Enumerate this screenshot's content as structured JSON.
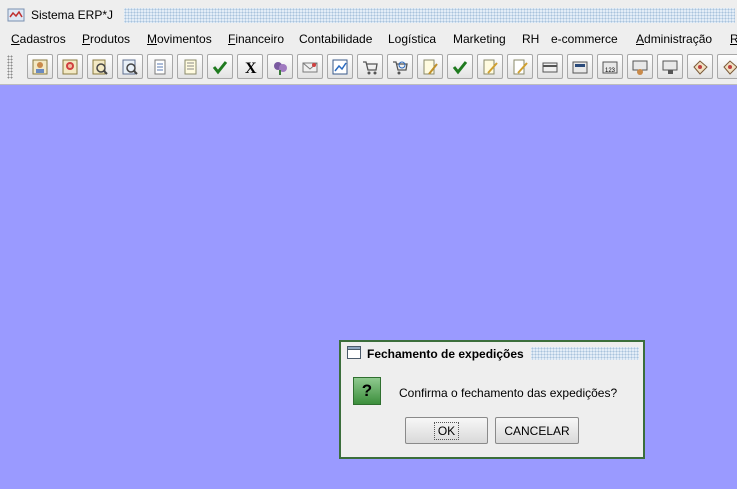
{
  "window": {
    "title": "Sistema ERP*J"
  },
  "menubar": {
    "items": [
      {
        "label": "Cadastros",
        "mnemonic": "C",
        "rest": "adastros"
      },
      {
        "label": "Produtos",
        "mnemonic": "P",
        "rest": "rodutos"
      },
      {
        "label": "Movimentos",
        "mnemonic": "M",
        "rest": "ovimentos"
      },
      {
        "label": "Financeiro",
        "mnemonic": "F",
        "rest": "inanceiro"
      },
      {
        "label": "Contabilidade",
        "mnemonic": "",
        "rest": "Contabilidade"
      },
      {
        "label": "Logística",
        "mnemonic": "",
        "rest": "Logística"
      },
      {
        "label": "Marketing",
        "mnemonic": "",
        "rest": "Marketing"
      },
      {
        "label": "RH",
        "mnemonic": "",
        "rest": "RH"
      },
      {
        "label": "e-commerce",
        "mnemonic": "",
        "rest": "e-commerce"
      },
      {
        "label": "Administração",
        "mnemonic": "A",
        "rest": "dministração"
      },
      {
        "label": "R",
        "mnemonic": "R",
        "rest": ""
      }
    ]
  },
  "toolbar": {
    "buttons": [
      "contact-card-icon",
      "contact-card-red-icon",
      "search-person-icon",
      "search-person-alt-icon",
      "document-list-icon",
      "checklist-icon",
      "checkmark-icon",
      "close-x-icon",
      "flowers-icon",
      "envelope-icon",
      "chart-icon",
      "shopping-cart-icon",
      "shopping-cart-search-icon",
      "document-tools-icon",
      "checkmark-green-icon",
      "document-pencil-icon",
      "document-pencil-alt-icon",
      "card-icon",
      "card-machine-icon",
      "card-number-icon",
      "terminal-user-icon",
      "terminal-lock-icon",
      "box-tag-icon",
      "box-tag-alt-icon"
    ]
  },
  "dialog": {
    "title": "Fechamento de expedições",
    "message": "Confirma o fechamento das expedições?",
    "ok_label": "OK",
    "cancel_label": "CANCELAR",
    "border_color": "#3b6e3b"
  },
  "colors": {
    "desktop": "#9a9aff",
    "chrome": "#eeeeee"
  }
}
